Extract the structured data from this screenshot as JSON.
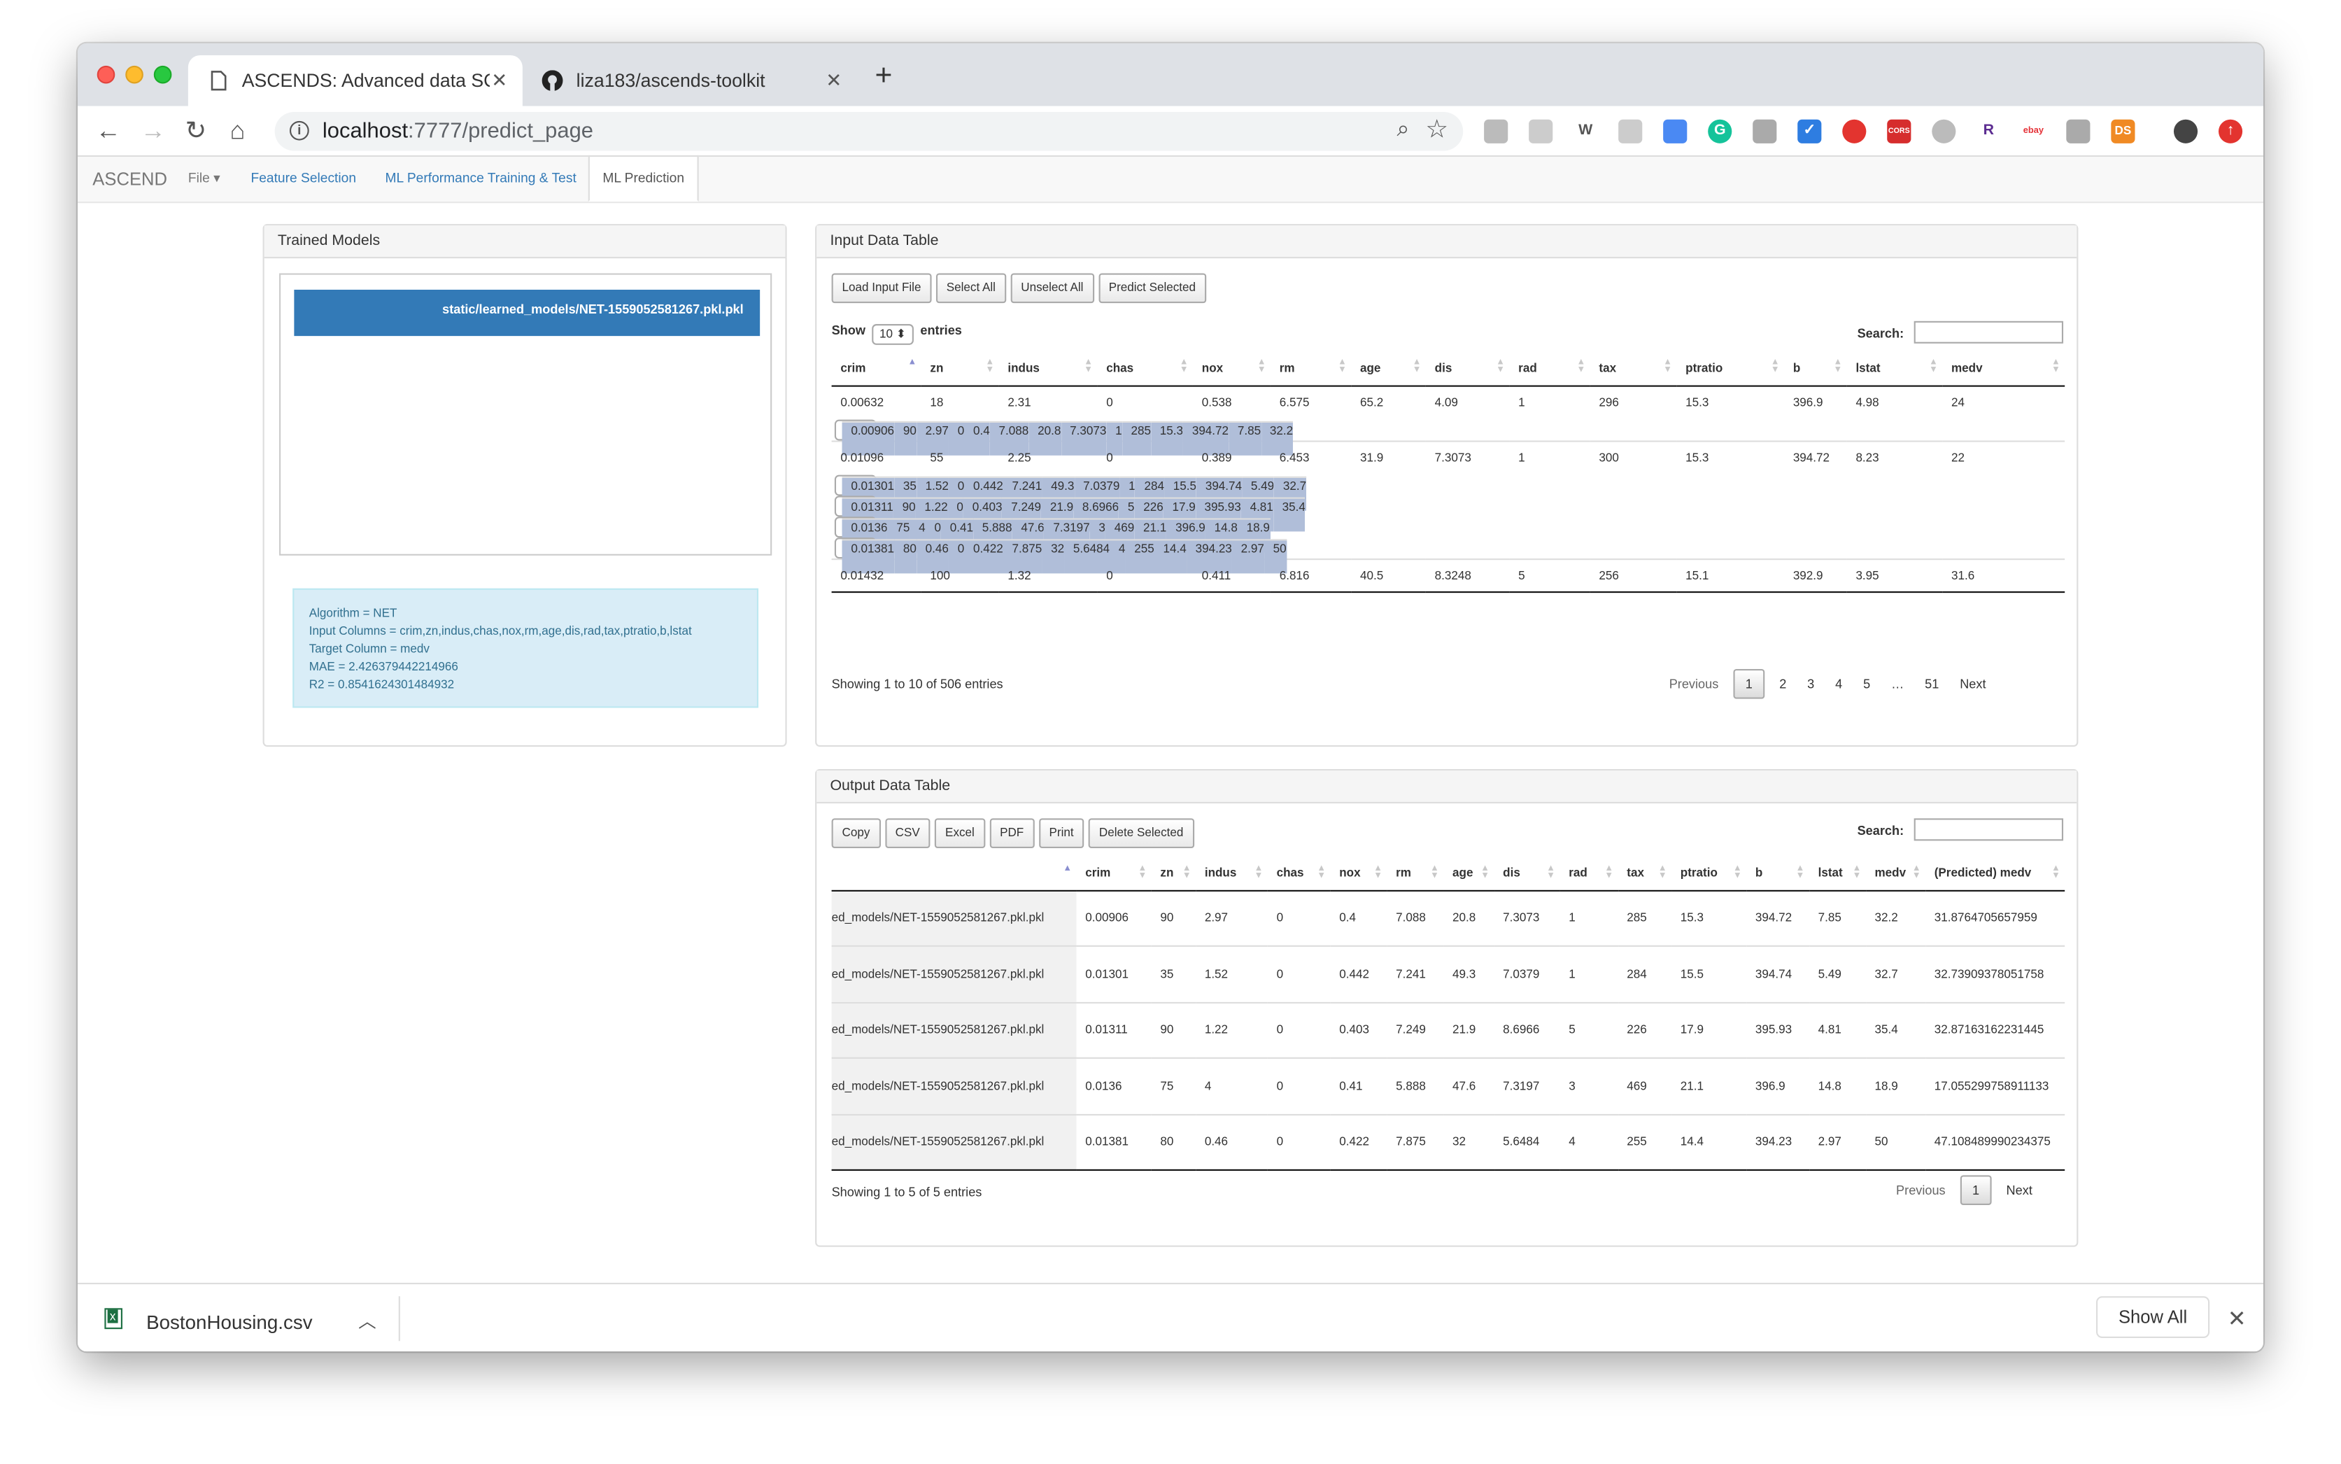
{
  "browser": {
    "tabs": [
      {
        "title": "ASCENDS: Advanced data SCIE"
      },
      {
        "title": "liza183/ascends-toolkit"
      }
    ],
    "new_tab": "+",
    "url_host": "localhost",
    "url_path": ":7777/predict_page"
  },
  "app": {
    "brand": "ASCEND",
    "file_menu": "File ▾",
    "nav": [
      "Feature Selection",
      "ML Performance Training & Test",
      "ML Prediction"
    ]
  },
  "trained_models": {
    "title": "Trained Models",
    "selected_model": "static/learned_models/NET-1559052581267.pkl.pkl",
    "info": [
      "Algorithm = NET",
      "Input Columns = crim,zn,indus,chas,nox,rm,age,dis,rad,tax,ptratio,b,lstat",
      "Target Column = medv",
      "MAE = 2.426379442214966",
      "R2 = 0.8541624301484932"
    ]
  },
  "input_table": {
    "title": "Input Data Table",
    "buttons": [
      "Load Input File",
      "Select All",
      "Unselect All",
      "Predict Selected"
    ],
    "show_label": "Show",
    "length_value": "10 ⬍",
    "entries_label": "entries",
    "search_label": "Search:",
    "columns": [
      "crim",
      "zn",
      "indus",
      "chas",
      "nox",
      "rm",
      "age",
      "dis",
      "rad",
      "tax",
      "ptratio",
      "b",
      "lstat",
      "medv"
    ],
    "rows": [
      [
        "0.00632",
        "18",
        "2.31",
        "0",
        "0.538",
        "6.575",
        "65.2",
        "4.09",
        "1",
        "296",
        "15.3",
        "396.9",
        "4.98",
        "24"
      ],
      [
        "0.00906",
        "90",
        "2.97",
        "0",
        "0.4",
        "7.088",
        "20.8",
        "7.3073",
        "1",
        "285",
        "15.3",
        "394.72",
        "7.85",
        "32.2"
      ],
      [
        "0.01096",
        "55",
        "2.25",
        "0",
        "0.389",
        "6.453",
        "31.9",
        "7.3073",
        "1",
        "300",
        "15.3",
        "394.72",
        "8.23",
        "22"
      ],
      [
        "0.01301",
        "35",
        "1.52",
        "0",
        "0.442",
        "7.241",
        "49.3",
        "7.0379",
        "1",
        "284",
        "15.5",
        "394.74",
        "5.49",
        "32.7"
      ],
      [
        "0.01311",
        "90",
        "1.22",
        "0",
        "0.403",
        "7.249",
        "21.9",
        "8.6966",
        "5",
        "226",
        "17.9",
        "395.93",
        "4.81",
        "35.4"
      ],
      [
        "0.0136",
        "75",
        "4",
        "0",
        "0.41",
        "5.888",
        "47.6",
        "7.3197",
        "3",
        "469",
        "21.1",
        "396.9",
        "14.8",
        "18.9"
      ],
      [
        "0.01381",
        "80",
        "0.46",
        "0",
        "0.422",
        "7.875",
        "32",
        "5.6484",
        "4",
        "255",
        "14.4",
        "394.23",
        "2.97",
        "50"
      ],
      [
        "0.01432",
        "100",
        "1.32",
        "0",
        "0.411",
        "6.816",
        "40.5",
        "8.3248",
        "5",
        "256",
        "15.1",
        "392.9",
        "3.95",
        "31.6"
      ]
    ],
    "selected_rows": [
      1,
      3,
      4,
      5,
      6
    ],
    "info": "Showing 1 to 10 of 506 entries",
    "pagination": [
      "Previous",
      "1",
      "2",
      "3",
      "4",
      "5",
      "…",
      "51",
      "Next"
    ]
  },
  "output_table": {
    "title": "Output Data Table",
    "buttons": [
      "Copy",
      "CSV",
      "Excel",
      "PDF",
      "Print",
      "Delete Selected"
    ],
    "search_label": "Search:",
    "columns": [
      "",
      "crim",
      "zn",
      "indus",
      "chas",
      "nox",
      "rm",
      "age",
      "dis",
      "rad",
      "tax",
      "ptratio",
      "b",
      "lstat",
      "medv",
      "(Predicted) medv"
    ],
    "rows": [
      [
        "ed_models/NET-1559052581267.pkl.pkl",
        "0.00906",
        "90",
        "2.97",
        "0",
        "0.4",
        "7.088",
        "20.8",
        "7.3073",
        "1",
        "285",
        "15.3",
        "394.72",
        "7.85",
        "32.2",
        "31.8764705657959"
      ],
      [
        "ed_models/NET-1559052581267.pkl.pkl",
        "0.01301",
        "35",
        "1.52",
        "0",
        "0.442",
        "7.241",
        "49.3",
        "7.0379",
        "1",
        "284",
        "15.5",
        "394.74",
        "5.49",
        "32.7",
        "32.73909378051758"
      ],
      [
        "ed_models/NET-1559052581267.pkl.pkl",
        "0.01311",
        "90",
        "1.22",
        "0",
        "0.403",
        "7.249",
        "21.9",
        "8.6966",
        "5",
        "226",
        "17.9",
        "395.93",
        "4.81",
        "35.4",
        "32.87163162231445"
      ],
      [
        "ed_models/NET-1559052581267.pkl.pkl",
        "0.0136",
        "75",
        "4",
        "0",
        "0.41",
        "5.888",
        "47.6",
        "7.3197",
        "3",
        "469",
        "21.1",
        "396.9",
        "14.8",
        "18.9",
        "17.055299758911133"
      ],
      [
        "ed_models/NET-1559052581267.pkl.pkl",
        "0.01381",
        "80",
        "0.46",
        "0",
        "0.422",
        "7.875",
        "32",
        "5.6484",
        "4",
        "255",
        "14.4",
        "394.23",
        "2.97",
        "50",
        "47.108489990234375"
      ]
    ],
    "info": "Showing 1 to 5 of 5 entries",
    "pagination": [
      "Previous",
      "1",
      "Next"
    ]
  },
  "downloads": {
    "file": "BostonHousing.csv",
    "show_all": "Show All"
  },
  "colors": {
    "primary": "#337ab7",
    "selected_row": "#b0bed9",
    "info_bg": "#d9edf7"
  }
}
